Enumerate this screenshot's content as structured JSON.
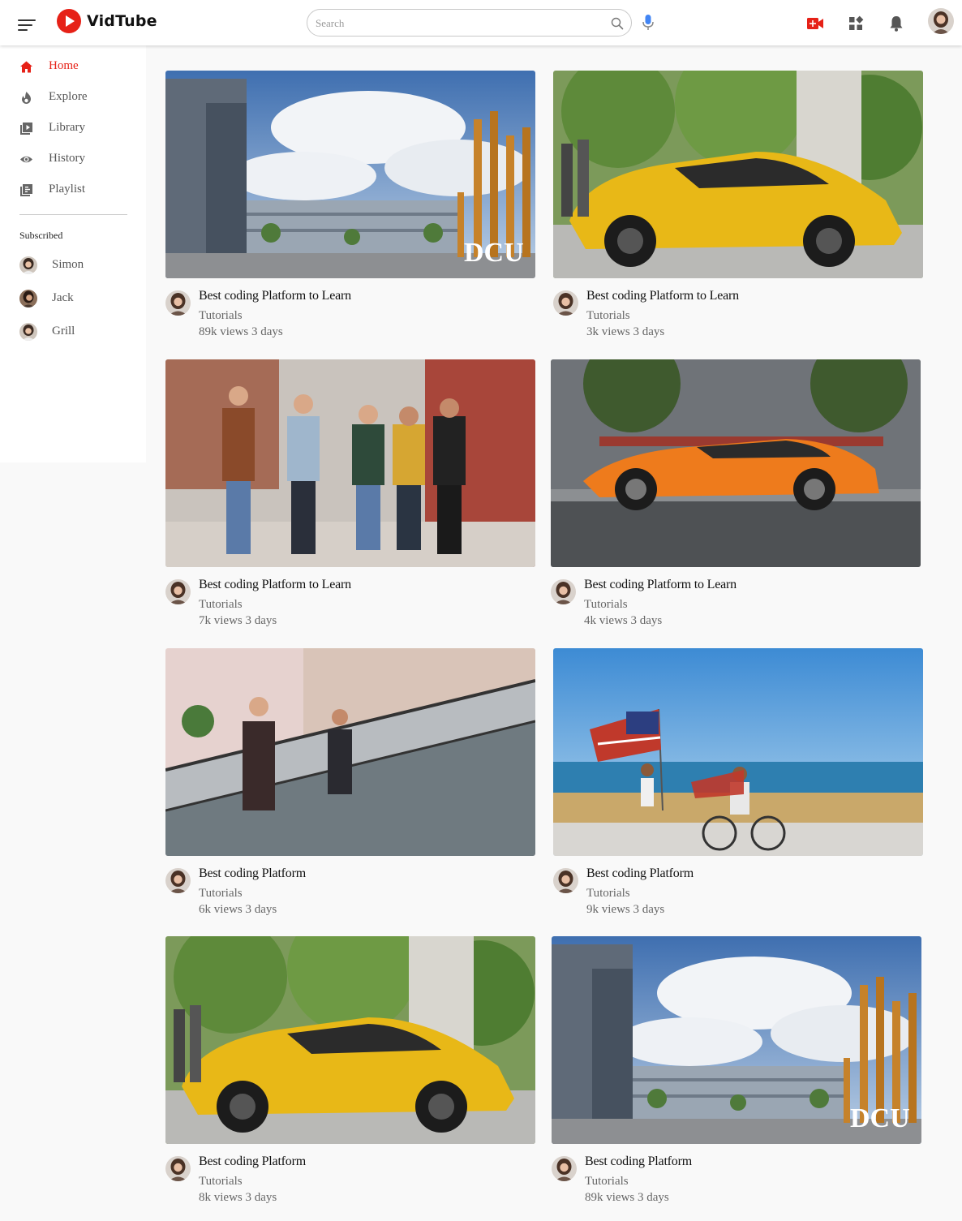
{
  "app": {
    "name": "VidTube"
  },
  "header": {
    "search_placeholder": "Search",
    "icons": [
      "menu-icon",
      "search-icon",
      "mic-icon",
      "create-video-icon",
      "apps-icon",
      "notifications-icon",
      "user-avatar"
    ]
  },
  "sidebar": {
    "items": [
      {
        "label": "Home",
        "icon": "home-icon",
        "active": true
      },
      {
        "label": "Explore",
        "icon": "explore-icon",
        "active": false
      },
      {
        "label": "Library",
        "icon": "library-icon",
        "active": false
      },
      {
        "label": "History",
        "icon": "history-icon",
        "active": false
      },
      {
        "label": "Playlist",
        "icon": "playlist-icon",
        "active": false
      }
    ],
    "subscribed_heading": "Subscribed",
    "subscriptions": [
      {
        "name": "Simon"
      },
      {
        "name": "Jack"
      },
      {
        "name": "Grill"
      }
    ]
  },
  "videos": [
    {
      "title": "Best coding Platform to Learn",
      "channel": "Tutorials",
      "stats": "89k views 3 days",
      "thumbnail": "campus-buildings-dcu"
    },
    {
      "title": "Best coding Platform to Learn",
      "channel": "Tutorials",
      "stats": "3k views 3 days",
      "thumbnail": "yellow-sports-car"
    },
    {
      "title": "Best coding Platform to Learn",
      "channel": "Tutorials",
      "stats": "7k views 3 days",
      "thumbnail": "friends-walking-street"
    },
    {
      "title": "Best coding Platform to Learn",
      "channel": "Tutorials",
      "stats": "4k views 3 days",
      "thumbnail": "orange-sports-car"
    },
    {
      "title": "Best coding Platform",
      "channel": "Tutorials",
      "stats": "6k views 3 days",
      "thumbnail": "mall-escalator"
    },
    {
      "title": "Best coding Platform",
      "channel": "Tutorials",
      "stats": "9k views 3 days",
      "thumbnail": "flag-beach-cyclist"
    },
    {
      "title": "Best coding Platform",
      "channel": "Tutorials",
      "stats": "8k views 3 days",
      "thumbnail": "yellow-sports-car"
    },
    {
      "title": "Best coding Platform",
      "channel": "Tutorials",
      "stats": "89k views 3 days",
      "thumbnail": "campus-buildings-dcu"
    }
  ],
  "colors": {
    "accent": "#e62117",
    "mic": "#4285f4",
    "background": "#f9f9f9"
  }
}
